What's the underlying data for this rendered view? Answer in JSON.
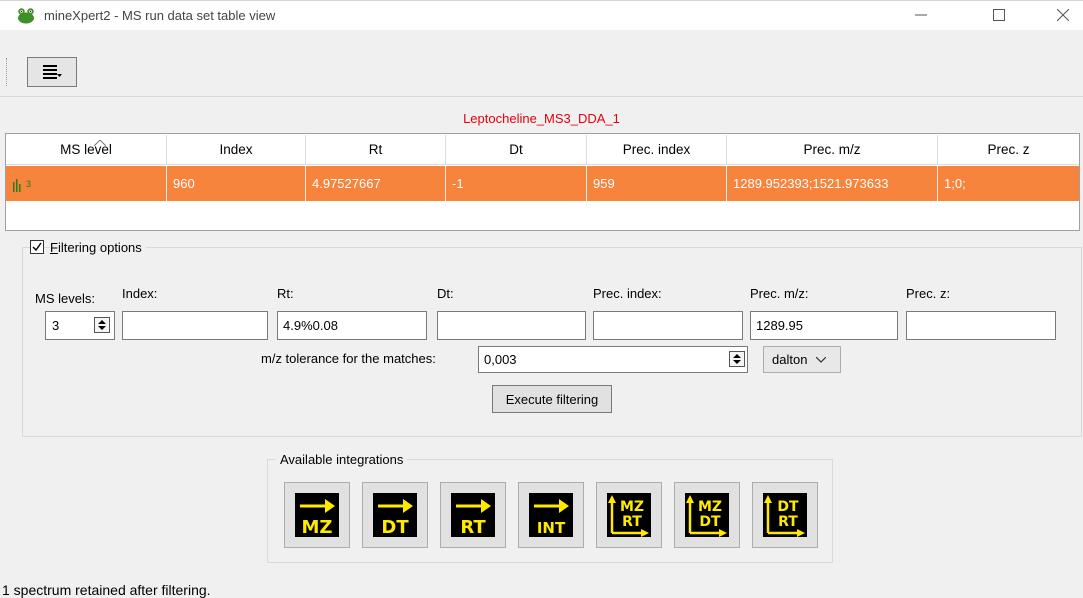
{
  "window": {
    "title": "mineXpert2 - MS run data set table view"
  },
  "table": {
    "dataset_title": "Leptocheline_MS3_DDA_1",
    "columns": [
      "MS level",
      "Index",
      "Rt",
      "Dt",
      "Prec. index",
      "Prec. m/z",
      "Prec. z"
    ],
    "rows": [
      {
        "ms_level_icon": "ms-level-3-icon",
        "ms_level_sup": "3",
        "index": "960",
        "rt": "4.97527667",
        "dt": "-1",
        "prec_index": "959",
        "prec_mz": "1289.952393;1521.973633",
        "prec_z": "1;0;"
      }
    ],
    "selected_row_color": "#f6843c"
  },
  "filtering": {
    "enabled": true,
    "group_label_prefix": "",
    "group_label_accel": "F",
    "group_label_rest": "iltering options",
    "ms_levels_label": "MS levels:",
    "ms_levels_value": "3",
    "labels": {
      "index": "Index:",
      "rt": "Rt:",
      "dt": "Dt:",
      "prec_index": "Prec. index:",
      "prec_mz": "Prec. m/z:",
      "prec_z": "Prec. z:"
    },
    "values": {
      "index": "",
      "rt": "4.9%0.08",
      "dt": "",
      "prec_index": "",
      "prec_mz": "1289.95",
      "prec_z": ""
    },
    "tolerance_label": "m/z tolerance for the matches:",
    "tolerance_value": "0,003",
    "tolerance_unit": "dalton",
    "execute_label": "Execute filtering"
  },
  "integrations": {
    "label": "Available integrations",
    "buttons": [
      {
        "icon": "integrate-to-mz-icon",
        "top": "",
        "bottom": "MZ"
      },
      {
        "icon": "integrate-to-dt-icon",
        "top": "",
        "bottom": "DT"
      },
      {
        "icon": "integrate-to-rt-icon",
        "top": "",
        "bottom": "RT"
      },
      {
        "icon": "integrate-to-int-icon",
        "top": "",
        "bottom": "INT"
      },
      {
        "icon": "integrate-to-mz-rt-icon",
        "top": "MZ",
        "bottom": "RT"
      },
      {
        "icon": "integrate-to-mz-dt-icon",
        "top": "MZ",
        "bottom": "DT"
      },
      {
        "icon": "integrate-to-dt-rt-icon",
        "top": "DT",
        "bottom": "RT"
      }
    ],
    "icon_bg": "#000000",
    "icon_fg": "#ffe900"
  },
  "status": {
    "text": "1 spectrum retained after filtering."
  }
}
